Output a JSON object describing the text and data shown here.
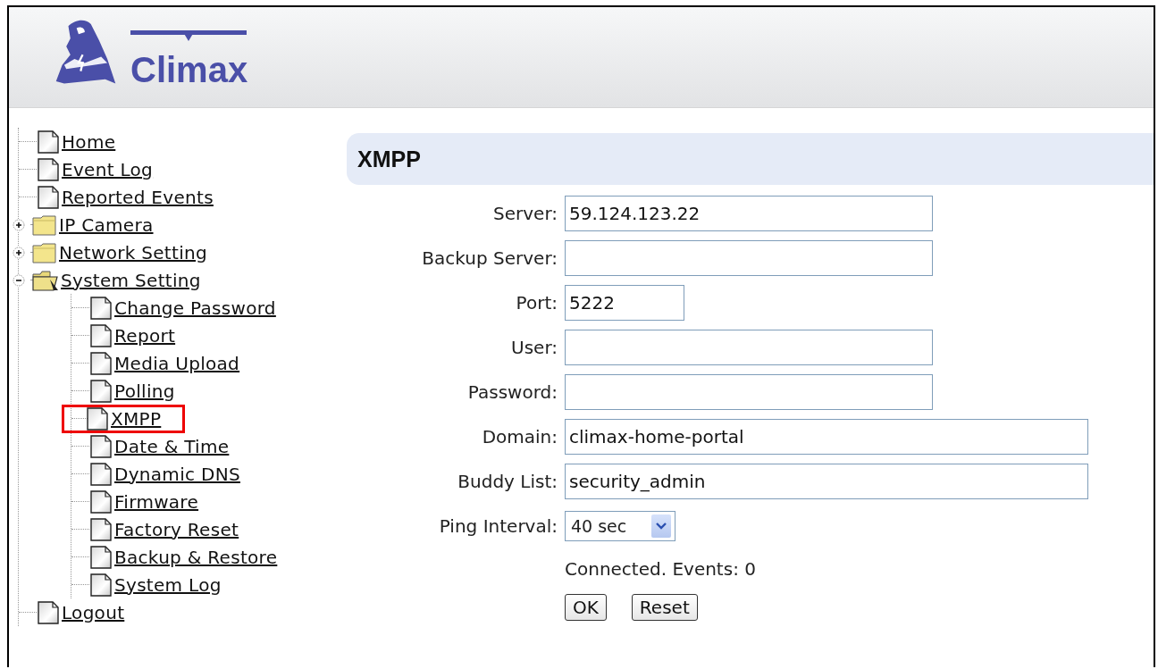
{
  "header": {
    "logo": "Climax"
  },
  "nav": [
    {
      "label": "Home",
      "kind": "page"
    },
    {
      "label": "Event Log",
      "kind": "page"
    },
    {
      "label": "Reported Events",
      "kind": "page"
    },
    {
      "label": "IP Camera",
      "kind": "folder",
      "expanded": false
    },
    {
      "label": "Network Setting",
      "kind": "folder",
      "expanded": false
    },
    {
      "label": "System Setting",
      "kind": "folder",
      "expanded": true,
      "children": [
        {
          "label": "Change Password",
          "kind": "page",
          "highlighted": false
        },
        {
          "label": "Report",
          "kind": "page",
          "highlighted": false
        },
        {
          "label": "Media Upload",
          "kind": "page",
          "highlighted": false
        },
        {
          "label": "Polling",
          "kind": "page",
          "highlighted": false
        },
        {
          "label": "XMPP",
          "kind": "page",
          "highlighted": true
        },
        {
          "label": "Date & Time",
          "kind": "page",
          "highlighted": false
        },
        {
          "label": "Dynamic DNS",
          "kind": "page",
          "highlighted": false
        },
        {
          "label": "Firmware",
          "kind": "page",
          "highlighted": false
        },
        {
          "label": "Factory Reset",
          "kind": "page",
          "highlighted": false
        },
        {
          "label": "Backup & Restore",
          "kind": "page",
          "highlighted": false
        },
        {
          "label": "System Log",
          "kind": "page",
          "highlighted": false
        }
      ]
    },
    {
      "label": "Logout",
      "kind": "page"
    }
  ],
  "main": {
    "title": "XMPP",
    "fields": [
      {
        "label": "Server:",
        "kind": "text",
        "value": "59.124.123.22"
      },
      {
        "label": "Backup Server:",
        "kind": "text"
      },
      {
        "label": "Port:",
        "kind": "port",
        "value": "5222"
      },
      {
        "label": "User:",
        "kind": "text"
      },
      {
        "label": "Password:",
        "kind": "password"
      },
      {
        "label": "Domain:",
        "kind": "wide",
        "value": "climax-home-portal"
      },
      {
        "label": "Buddy List:",
        "kind": "wide",
        "value": "security_admin"
      },
      {
        "label": "Ping Interval:",
        "kind": "select",
        "value": "40 sec"
      }
    ],
    "status": "Connected. Events: 0",
    "buttons": [
      "OK",
      "Reset"
    ]
  }
}
